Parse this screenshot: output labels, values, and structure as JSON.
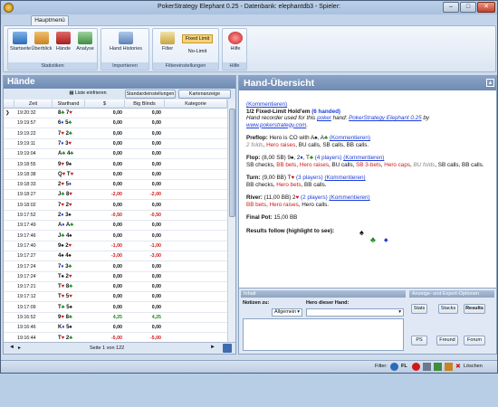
{
  "window": {
    "title": "PokerStrategy Elephant 0.25 - Datenbank: elephantdb3 - Spieler:",
    "min": "–",
    "max": "□",
    "close": "✕"
  },
  "tabs": [
    "Hauptmenü"
  ],
  "ribbon": {
    "groups": [
      {
        "label": "Statistiken",
        "buttons": [
          "Startseite",
          "Überblick",
          "Hände",
          "Analyse"
        ]
      },
      {
        "label": "Importieren",
        "buttons": [
          "Hand Histories"
        ]
      },
      {
        "label": "Filtereinstellungen",
        "buttons": [
          "Filter"
        ],
        "fixed_limit": "Fixed Limit",
        "no_limit": "No-Limit"
      },
      {
        "label": "Hilfe",
        "buttons": [
          "Hilfe"
        ]
      }
    ]
  },
  "left": {
    "title": "Hände",
    "list_btn": "Liste einfrieren",
    "std_btn": "Standardeinstellungen",
    "card_btn": "Kartenanzeige",
    "columns": [
      "Zeit",
      "Starthand",
      "$",
      "Big Blinds",
      "Kategorie"
    ],
    "rows": [
      {
        "zeit": "19:20:32",
        "c1": "8",
        "s1": "♣",
        "c2": "7",
        "s2": "♥",
        "usd": "0,00",
        "bb": "0,00"
      },
      {
        "zeit": "19:19:57",
        "c1": "6",
        "s1": "♦",
        "c2": "5",
        "s2": "♣",
        "usd": "0,00",
        "bb": "0,00"
      },
      {
        "zeit": "19:19:22",
        "c1": "7",
        "s1": "♥",
        "c2": "2",
        "s2": "♣",
        "usd": "0,00",
        "bb": "0,00"
      },
      {
        "zeit": "19:19:11",
        "c1": "7",
        "s1": "♦",
        "c2": "3",
        "s2": "♥",
        "usd": "0,00",
        "bb": "0,00"
      },
      {
        "zeit": "19:19:04",
        "c1": "A",
        "s1": "♣",
        "c2": "4",
        "s2": "♣",
        "usd": "0,00",
        "bb": "0,00"
      },
      {
        "zeit": "19:18:55",
        "c1": "9",
        "s1": "♥",
        "c2": "9",
        "s2": "♠",
        "usd": "0,00",
        "bb": "0,00"
      },
      {
        "zeit": "19:18:38",
        "c1": "Q",
        "s1": "♥",
        "c2": "T",
        "s2": "♥",
        "usd": "0,00",
        "bb": "0,00"
      },
      {
        "zeit": "19:18:33",
        "c1": "2",
        "s1": "♥",
        "c2": "5",
        "s2": "♦",
        "usd": "0,00",
        "bb": "0,00"
      },
      {
        "zeit": "19:18:27",
        "c1": "J",
        "s1": "♣",
        "c2": "8",
        "s2": "♥",
        "usd": "-2,00",
        "bb": "-2,00"
      },
      {
        "zeit": "19:18:02",
        "c1": "7",
        "s1": "♥",
        "c2": "2",
        "s2": "♥",
        "usd": "0,00",
        "bb": "0,00"
      },
      {
        "zeit": "19:17:52",
        "c1": "2",
        "s1": "♦",
        "c2": "3",
        "s2": "♠",
        "usd": "-0,50",
        "bb": "-0,50"
      },
      {
        "zeit": "19:17:49",
        "c1": "A",
        "s1": "♦",
        "c2": "A",
        "s2": "♣",
        "usd": "0,00",
        "bb": "0,00"
      },
      {
        "zeit": "19:17:46",
        "c1": "J",
        "s1": "♣",
        "c2": "4",
        "s2": "♠",
        "usd": "0,00",
        "bb": "0,00"
      },
      {
        "zeit": "19:17:40",
        "c1": "9",
        "s1": "♠",
        "c2": "2",
        "s2": "♥",
        "usd": "-1,00",
        "bb": "-1,00"
      },
      {
        "zeit": "19:17:27",
        "c1": "4",
        "s1": "♠",
        "c2": "4",
        "s2": "♠",
        "usd": "-3,00",
        "bb": "-3,00"
      },
      {
        "zeit": "19:17:24",
        "c1": "7",
        "s1": "♦",
        "c2": "3",
        "s2": "♣",
        "usd": "0,00",
        "bb": "0,00"
      },
      {
        "zeit": "19:17:24",
        "c1": "T",
        "s1": "♠",
        "c2": "2",
        "s2": "♥",
        "usd": "0,00",
        "bb": "0,00"
      },
      {
        "zeit": "19:17:21",
        "c1": "T",
        "s1": "♥",
        "c2": "8",
        "s2": "♣",
        "usd": "0,00",
        "bb": "0,00"
      },
      {
        "zeit": "19:17:12",
        "c1": "T",
        "s1": "♥",
        "c2": "5",
        "s2": "♥",
        "usd": "0,00",
        "bb": "0,00"
      },
      {
        "zeit": "19:17:09",
        "c1": "T",
        "s1": "♣",
        "c2": "5",
        "s2": "♠",
        "usd": "0,00",
        "bb": "0,00"
      },
      {
        "zeit": "19:16:52",
        "c1": "9",
        "s1": "♥",
        "c2": "8",
        "s2": "♣",
        "usd": "4,25",
        "bb": "4,25"
      },
      {
        "zeit": "19:16:46",
        "c1": "K",
        "s1": "♦",
        "c2": "5",
        "s2": "♠",
        "usd": "0,00",
        "bb": "0,00"
      },
      {
        "zeit": "19:16:44",
        "c1": "T",
        "s1": "♥",
        "c2": "2",
        "s2": "♣",
        "usd": "-5,00",
        "bb": "-5,00"
      }
    ],
    "pager": "Seite 1 von 122"
  },
  "right": {
    "title": "Hand-Übersicht",
    "kommentieren": "(Kommentieren)",
    "game_line_a": "1/2 Fixed-Limit Hold'em ",
    "game_line_b": "(6 handed)",
    "hr_text_a": "Hand recorder used for this ",
    "hr_poker": "poker",
    "hr_text_b": " hand: ",
    "hr_link": "PokerStrategy Elephant 0.25",
    "hr_by": " by ",
    "hr_site": "www.pokerstrategy.com",
    "preflop_head": "Preflop: ",
    "preflop_txt": "Hero is CO with A",
    "preflop_folds": "2 folds",
    "preflop_raise": "Hero raises",
    "preflop_rest": ", BU calls, SB calls, BB calls.",
    "flop_head": "Flop: ",
    "flop_pot": "(8,00 SB) 9",
    "flop_players": "(4 players)",
    "flop_sb_checks": "SB checks, ",
    "flop_bb_bets": "BB bets",
    "flop_hero_raises": "Hero raises",
    "flop_bu_calls": ", BU calls, ",
    "flop_sb_3bets": "SB 3-bets",
    "flop_hero_caps": "Hero caps",
    "flop_bu_folds": "BU folds",
    "flop_end": ", SB calls, BB calls.",
    "turn_head": "Turn: ",
    "turn_pot": "(9,00 BB) T",
    "turn_players": "(3 players)",
    "turn_bb_checks": "BB checks, ",
    "turn_hero_bets": "Hero bets",
    "turn_end": ", BB calls.",
    "river_head": "River: ",
    "river_pot": "(11,00 BB) 2",
    "river_players": "(2 players)",
    "river_bb_bets": "BB bets",
    "river_hero_raises": "Hero raises",
    "river_end": ", Hero calls.",
    "final_pot": "Final Pot: ",
    "final_val": "15,00 BB",
    "results": "Results follow (highlight to see):",
    "inhalt": "Inhalt",
    "notizen": "Notizen zu:",
    "notizen_sel": "Allgemein",
    "hero_hand": "Hero dieser Hand:",
    "export_head": "Anzeige- und Export-Optionen",
    "stats_btn": "Stats",
    "stacks_btn": "Stacks",
    "results_btn": "Results",
    "ps_btn": "PS",
    "freund_btn": "Freund",
    "forum_btn": "Forum"
  },
  "status": {
    "filter": "Filter:",
    "fl": "FL",
    "loeschen": "Löschen"
  }
}
